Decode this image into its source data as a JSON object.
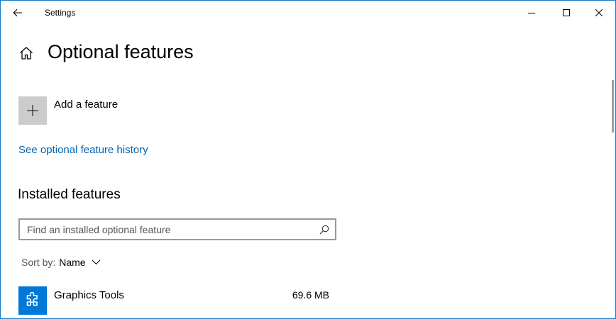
{
  "window": {
    "title": "Settings",
    "accent_color": "#0078d7",
    "link_color": "#0063b1"
  },
  "titlebar": {
    "back_icon": "arrow-left-icon",
    "minimize_icon": "minimize-icon",
    "maximize_icon": "maximize-icon",
    "close_icon": "close-icon"
  },
  "header": {
    "home_icon": "home-icon",
    "title": "Optional features"
  },
  "add_feature": {
    "icon": "plus-icon",
    "label": "Add a feature"
  },
  "history_link": "See optional feature history",
  "installed": {
    "title": "Installed features",
    "search": {
      "placeholder": "Find an installed optional feature",
      "value": "",
      "icon": "search-icon"
    },
    "sort": {
      "label": "Sort by:",
      "value": "Name",
      "icon": "chevron-down-icon"
    },
    "items": [
      {
        "name": "Graphics Tools",
        "size": "69.6 MB",
        "icon": "puzzle-piece-icon"
      }
    ]
  }
}
